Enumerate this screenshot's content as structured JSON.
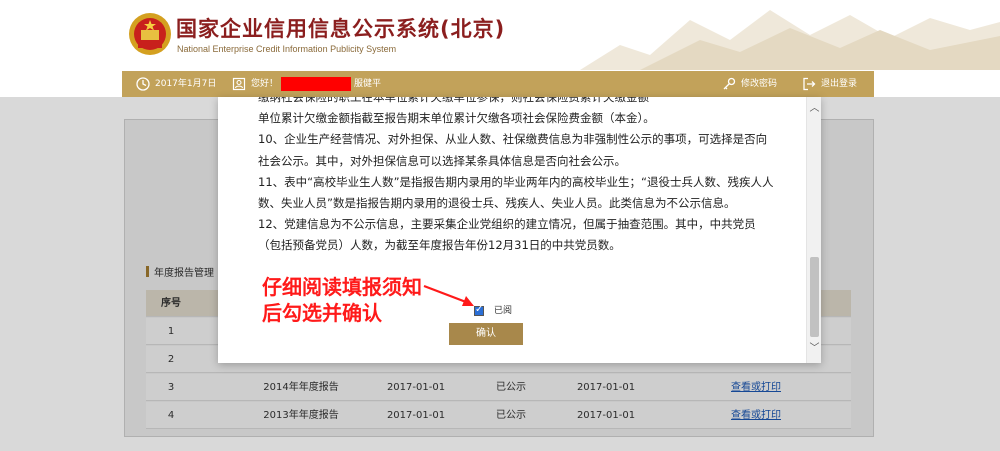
{
  "header": {
    "title": "国家企业信用信息公示系统(北京)",
    "subtitle": "National Enterprise Credit Information Publicity System"
  },
  "topbar": {
    "date": "2017年1月7日",
    "greeting": "您好！",
    "company_suffix": "服健平",
    "change_password": "修改密码",
    "logout": "退出登录"
  },
  "section": {
    "title": "年度报告管理"
  },
  "table": {
    "columns": [
      "序号",
      "",
      "",
      "",
      "",
      ""
    ],
    "rows": [
      {
        "no": "1",
        "name": "",
        "date1": "",
        "status": "",
        "date2": "",
        "action": ""
      },
      {
        "no": "2",
        "name": "",
        "date1": "",
        "status": "",
        "date2": "",
        "action": ""
      },
      {
        "no": "3",
        "name": "2014年年度报告",
        "date1": "2017-01-01",
        "status": "已公示",
        "date2": "2017-01-01",
        "action": "查看或打印"
      },
      {
        "no": "4",
        "name": "2013年年度报告",
        "date1": "2017-01-01",
        "status": "已公示",
        "date2": "2017-01-01",
        "action": "查看或打印"
      }
    ]
  },
  "modal": {
    "paragraphs": [
      "缴纳社会保险的职工在本单位累计欠缴单位参保，则社会保险费累计欠缴金额",
      "单位累计欠缴金额指截至报告期末单位累计欠缴各项社会保险费金额（本金）。",
      "10、企业生产经营情况、对外担保、从业人数、社保缴费信息为非强制性公示的事项，可选择是否向社会公示。其中，对外担保信息可以选择某条具体信息是否向社会公示。",
      "11、表中“高校毕业生人数”是指报告期内录用的毕业两年内的高校毕业生；“退役士兵人数、残疾人人数、失业人员”数是指报告期内录用的退役士兵、残疾人、失业人员。此类信息为不公示信息。",
      "12、党建信息为不公示信息，主要采集企业党组织的建立情况，但属于抽查范围。其中，中共党员（包括预备党员）人数，为截至年度报告年份12月31日的中共党员数。"
    ],
    "checkbox_label": "已阅",
    "checkbox_checked": true,
    "confirm_label": "确认"
  },
  "annotation": {
    "line1": "仔细阅读填报须知",
    "line2": "后勾选并确认"
  },
  "colors": {
    "accent": "#c2a25a",
    "button": "#a8884b",
    "annotation": "#ff1a1a",
    "title": "#8b1e1e"
  }
}
